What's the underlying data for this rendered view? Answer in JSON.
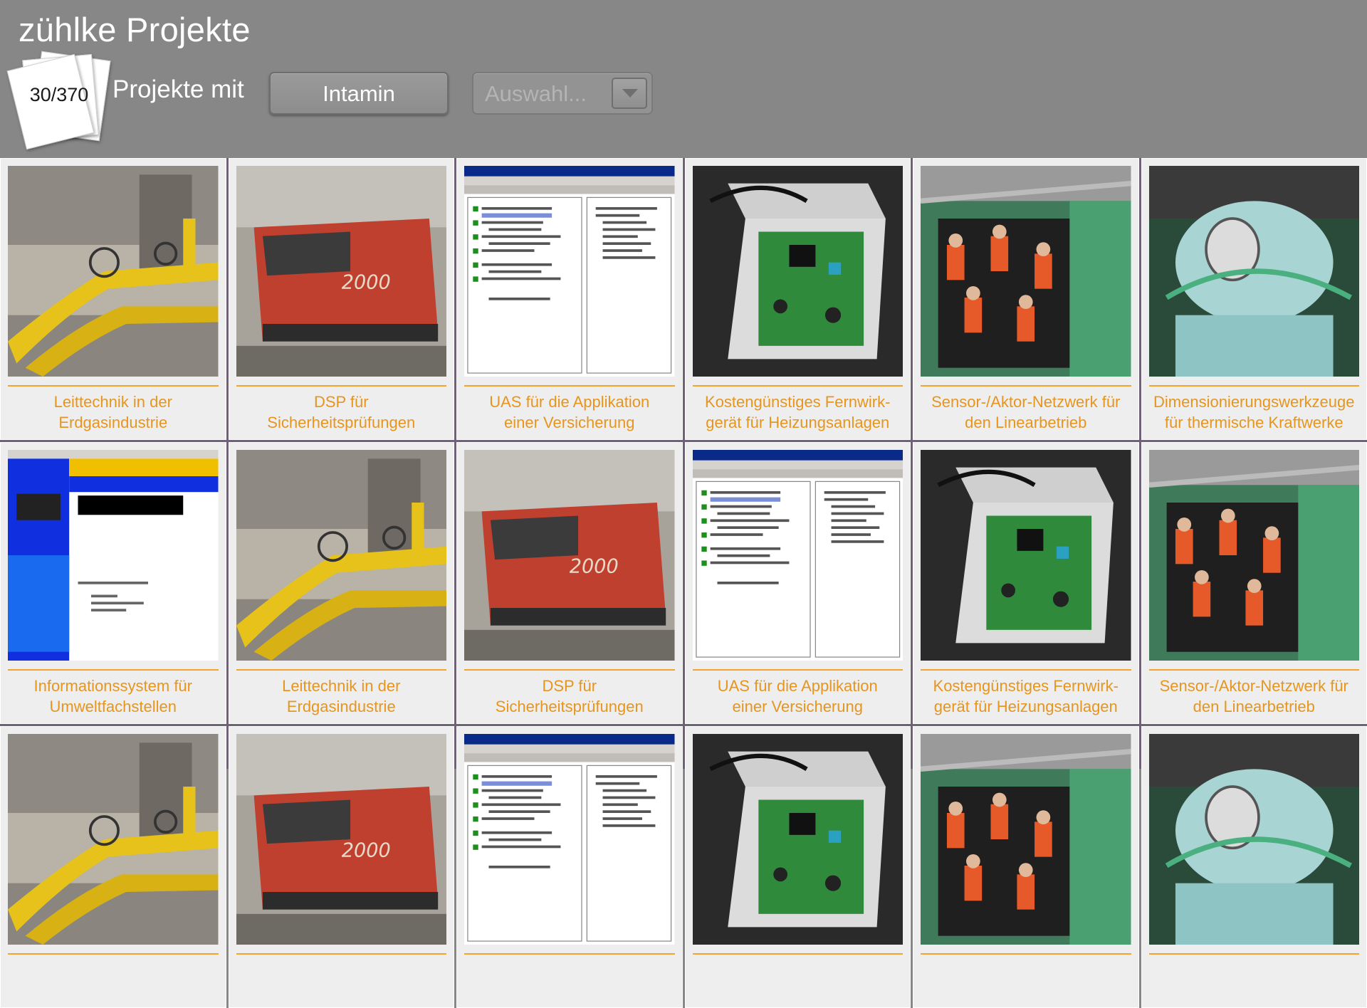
{
  "header": {
    "app_title": "zühlke Projekte",
    "counter": "30/370",
    "filter_label": "Projekte mit",
    "filter_value": "Intamin",
    "select_placeholder": "Auswahl..."
  },
  "colors": {
    "background": "#878787",
    "caption": "#e6951e",
    "separator": "#f2a42d"
  },
  "projects": [
    {
      "line1": "Leittechnik in der",
      "line2": "Erdgasindustrie",
      "image": "gas-pipes"
    },
    {
      "line1": "DSP für",
      "line2": "Sicherheitsprüfungen",
      "image": "red-train"
    },
    {
      "line1": "UAS für die Applikation",
      "line2": "einer Versicherung",
      "image": "software-tree"
    },
    {
      "line1": "Kostengünstiges Fernwirk-",
      "line2": "gerät für Heizungsanlagen",
      "image": "circuit-box"
    },
    {
      "line1": "Sensor-/Aktor-Netzwerk für",
      "line2": "den Linearbetrieb",
      "image": "roller-coaster"
    },
    {
      "line1": "Dimensionierungswerkzeuge",
      "line2": "für thermische Kraftwerke",
      "image": "turbine"
    },
    {
      "line1": "Informationssystem für",
      "line2": "Umweltfachstellen",
      "image": "website"
    },
    {
      "line1": "Leittechnik in der",
      "line2": "Erdgasindustrie",
      "image": "gas-pipes"
    },
    {
      "line1": "DSP für",
      "line2": "Sicherheitsprüfungen",
      "image": "red-train"
    },
    {
      "line1": "UAS für die Applikation",
      "line2": "einer Versicherung",
      "image": "software-tree"
    },
    {
      "line1": "Kostengünstiges Fernwirk-",
      "line2": "gerät für Heizungsanlagen",
      "image": "circuit-box"
    },
    {
      "line1": "Sensor-/Aktor-Netzwerk für",
      "line2": "den Linearbetrieb",
      "image": "roller-coaster"
    },
    {
      "line1": "",
      "line2": "",
      "image": "gas-pipes"
    },
    {
      "line1": "",
      "line2": "",
      "image": "red-train"
    },
    {
      "line1": "",
      "line2": "",
      "image": "software-tree"
    },
    {
      "line1": "",
      "line2": "",
      "image": "circuit-box"
    },
    {
      "line1": "",
      "line2": "",
      "image": "roller-coaster"
    },
    {
      "line1": "",
      "line2": "",
      "image": "turbine"
    }
  ]
}
